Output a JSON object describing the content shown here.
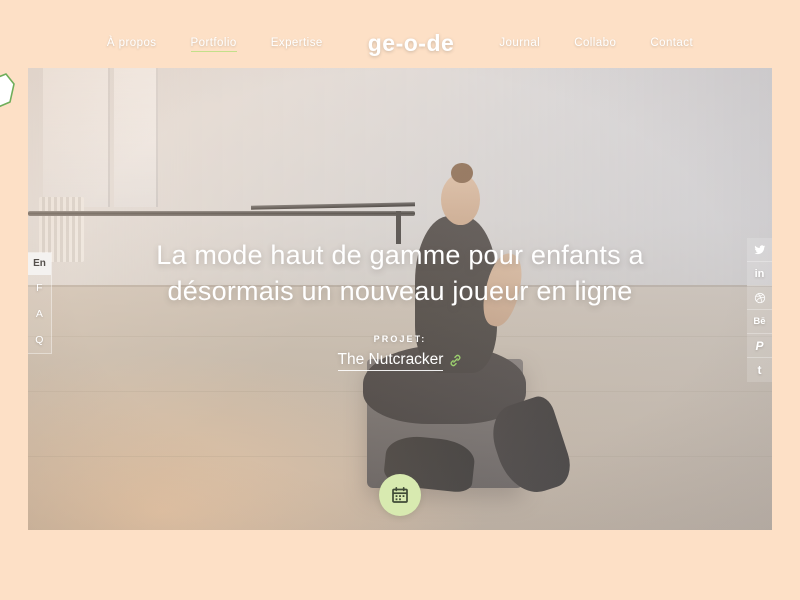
{
  "theme": {
    "page_background": "#fde0c6",
    "accent_green": "#c3e08a",
    "button_green": "#d8eab0",
    "text_on_hero": "#ffffff"
  },
  "brand": {
    "logo": "ge-o-de",
    "badge_icon": "geode-gem-icon"
  },
  "nav": {
    "left_links": [
      {
        "label": "À propos",
        "active": false
      },
      {
        "label": "Portfolio",
        "active": true
      },
      {
        "label": "Expertise",
        "active": false
      }
    ],
    "right_links": [
      {
        "label": "Journal",
        "active": false
      },
      {
        "label": "Collabo",
        "active": false
      },
      {
        "label": "Contact",
        "active": false
      }
    ]
  },
  "hero": {
    "headline": "La mode haut de gamme pour enfants a désormais un nouveau joueur en ligne",
    "project_label": "PROJET:",
    "project_name": "The Nutcracker",
    "project_link_icon": "link-chain-icon"
  },
  "left_tabs": {
    "language": "En",
    "faq_letters": [
      "F",
      "A",
      "Q"
    ]
  },
  "social": [
    {
      "name": "twitter",
      "glyph": "twitter-icon"
    },
    {
      "name": "linkedin",
      "glyph": "in"
    },
    {
      "name": "dribbble",
      "glyph": "dribbble-icon"
    },
    {
      "name": "behance",
      "glyph": "Bē"
    },
    {
      "name": "pinterest",
      "glyph": "P"
    },
    {
      "name": "tumblr",
      "glyph": "t"
    }
  ],
  "cta": {
    "icon": "calendar-icon"
  }
}
